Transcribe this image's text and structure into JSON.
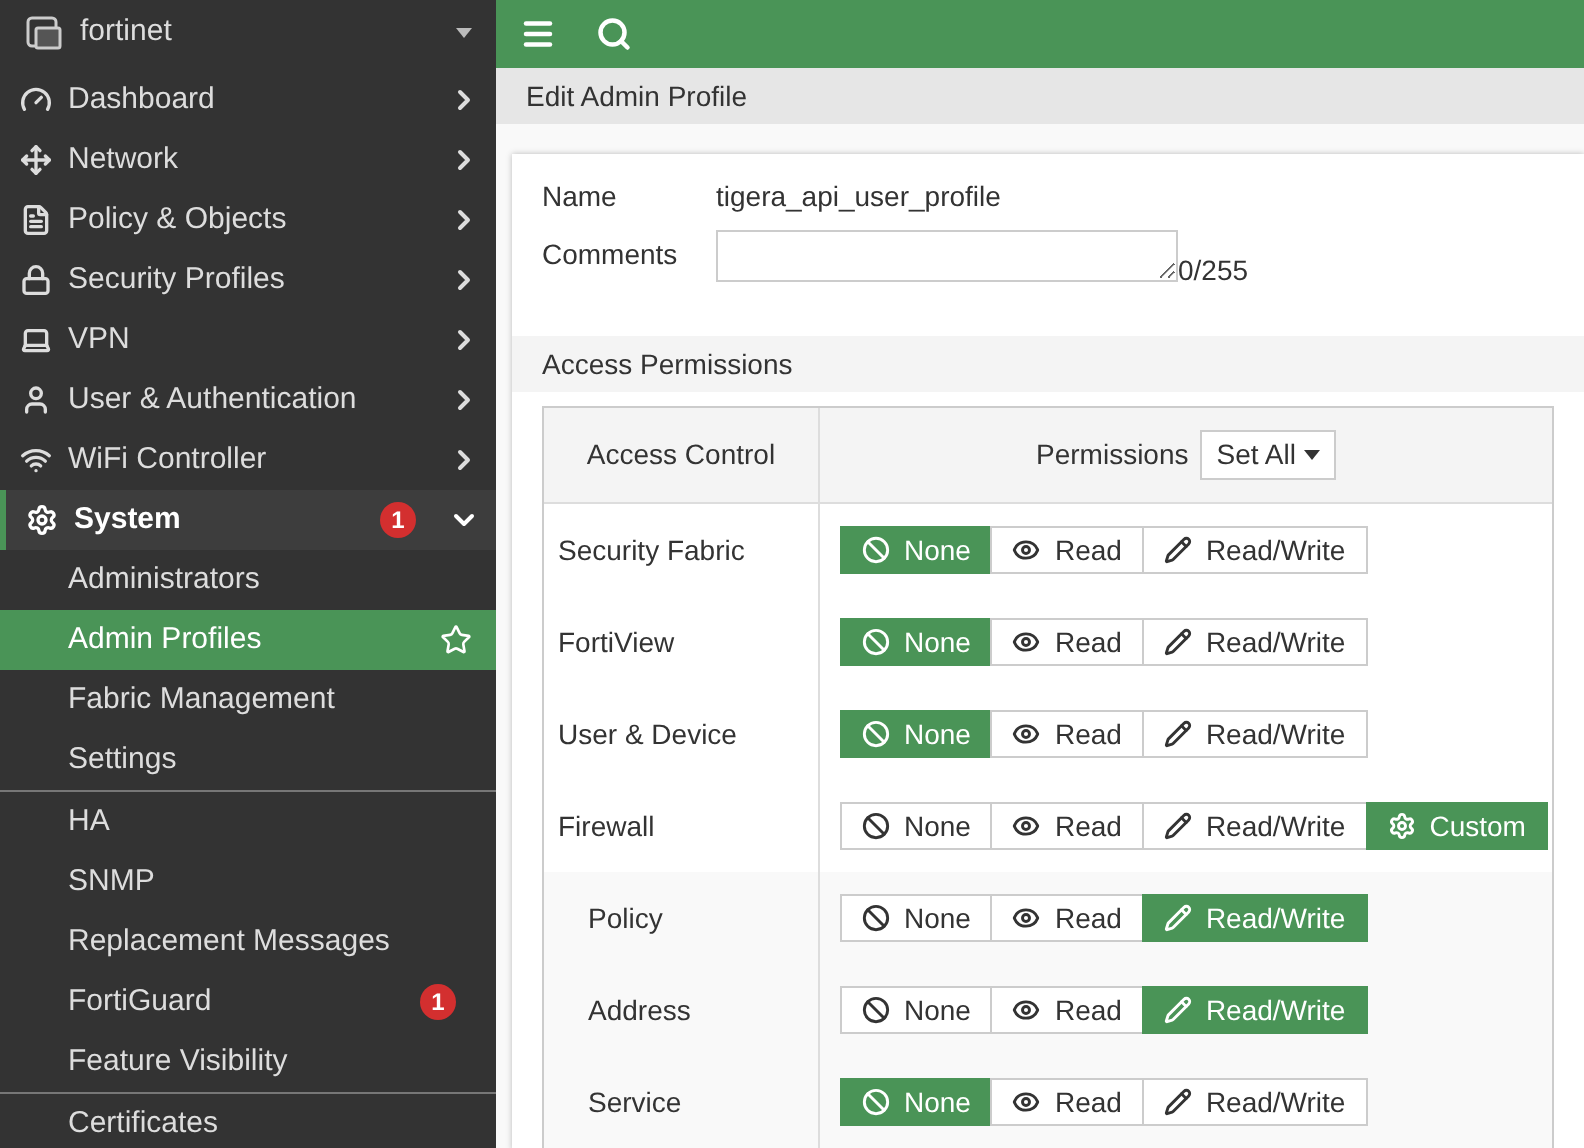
{
  "sidebar": {
    "brand": "fortinet",
    "items": [
      {
        "label": "Dashboard",
        "expanded": false,
        "selected": false
      },
      {
        "label": "Network",
        "expanded": false,
        "selected": false
      },
      {
        "label": "Policy & Objects",
        "expanded": false,
        "selected": false
      },
      {
        "label": "Security Profiles",
        "expanded": false,
        "selected": false
      },
      {
        "label": "VPN",
        "expanded": false,
        "selected": false
      },
      {
        "label": "User & Authentication",
        "expanded": false,
        "selected": false
      },
      {
        "label": "WiFi Controller",
        "expanded": false,
        "selected": false
      },
      {
        "label": "System",
        "expanded": true,
        "selected": true,
        "badge": "1",
        "child_groups": [
          [
            {
              "label": "Administrators",
              "selected": false
            },
            {
              "label": "Admin Profiles",
              "selected": true
            },
            {
              "label": "Fabric Management",
              "selected": false
            },
            {
              "label": "Settings",
              "selected": false
            }
          ],
          [
            {
              "label": "HA",
              "selected": false
            },
            {
              "label": "SNMP",
              "selected": false
            },
            {
              "label": "Replacement Messages",
              "selected": false
            },
            {
              "label": "FortiGuard",
              "selected": false,
              "badge": "1"
            },
            {
              "label": "Feature Visibility",
              "selected": false
            }
          ],
          [
            {
              "label": "Certificates",
              "selected": false
            }
          ]
        ]
      }
    ]
  },
  "page_title": "Edit Admin Profile",
  "form": {
    "name_label": "Name",
    "name_value": "tigera_api_user_profile",
    "comments_label": "Comments",
    "comments_counter": "0/255"
  },
  "access": {
    "section_title": "Access Permissions",
    "col_access": "Access Control",
    "col_permissions": "Permissions",
    "set_all": "Set All",
    "rows": [
      {
        "label": "Security Fabric",
        "options": [
          {
            "kind": "none",
            "label": "None",
            "selected": true
          },
          {
            "kind": "read",
            "label": "Read",
            "selected": false
          },
          {
            "kind": "readwrite",
            "label": "Read/Write",
            "selected": false
          }
        ]
      },
      {
        "label": "FortiView",
        "options": [
          {
            "kind": "none",
            "label": "None",
            "selected": true
          },
          {
            "kind": "read",
            "label": "Read",
            "selected": false
          },
          {
            "kind": "readwrite",
            "label": "Read/Write",
            "selected": false
          }
        ]
      },
      {
        "label": "User & Device",
        "options": [
          {
            "kind": "none",
            "label": "None",
            "selected": true
          },
          {
            "kind": "read",
            "label": "Read",
            "selected": false
          },
          {
            "kind": "readwrite",
            "label": "Read/Write",
            "selected": false
          }
        ]
      },
      {
        "label": "Firewall",
        "options": [
          {
            "kind": "none",
            "label": "None",
            "selected": false
          },
          {
            "kind": "read",
            "label": "Read",
            "selected": false
          },
          {
            "kind": "readwrite",
            "label": "Read/Write",
            "selected": false
          },
          {
            "kind": "custom",
            "label": "Custom",
            "selected": true
          }
        ],
        "children": [
          {
            "label": "Policy",
            "options": [
              {
                "kind": "none",
                "label": "None",
                "selected": false
              },
              {
                "kind": "read",
                "label": "Read",
                "selected": false
              },
              {
                "kind": "readwrite",
                "label": "Read/Write",
                "selected": true
              }
            ]
          },
          {
            "label": "Address",
            "options": [
              {
                "kind": "none",
                "label": "None",
                "selected": false
              },
              {
                "kind": "read",
                "label": "Read",
                "selected": false
              },
              {
                "kind": "readwrite",
                "label": "Read/Write",
                "selected": true
              }
            ]
          },
          {
            "label": "Service",
            "options": [
              {
                "kind": "none",
                "label": "None",
                "selected": true
              },
              {
                "kind": "read",
                "label": "Read",
                "selected": false
              },
              {
                "kind": "readwrite",
                "label": "Read/Write",
                "selected": false
              }
            ]
          }
        ]
      }
    ]
  }
}
